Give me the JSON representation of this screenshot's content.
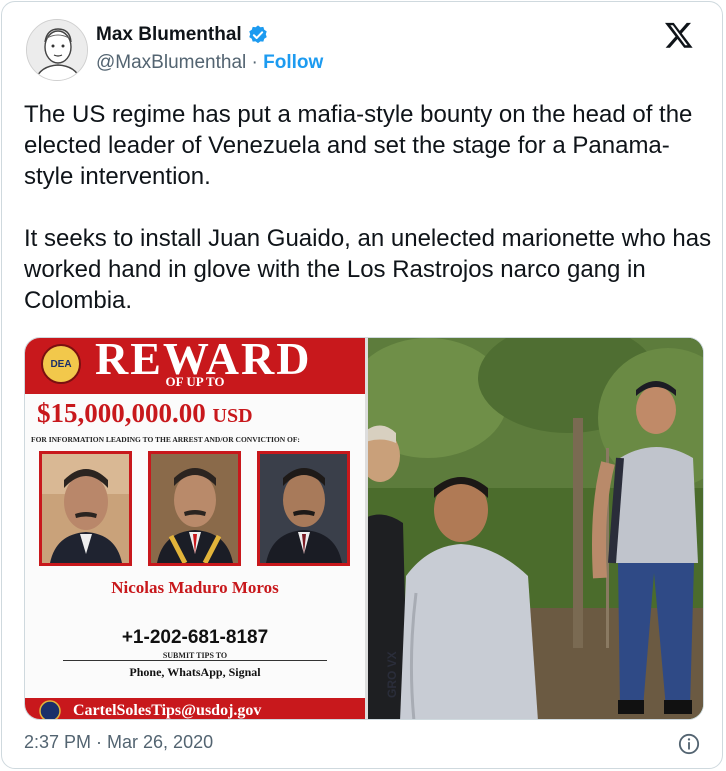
{
  "author": {
    "name": "Max Blumenthal",
    "handle": "@MaxBlumenthal",
    "separator": "·",
    "follow_label": "Follow"
  },
  "icons": {
    "verified": "verified-badge-icon",
    "platform": "x-logo-icon",
    "info": "info-icon"
  },
  "colors": {
    "accent": "#1d9bf0",
    "poster_red": "#c8181c",
    "secondary_text": "#536471"
  },
  "tweet": {
    "text": "The US regime has put a mafia-style bounty on the head of the elected leader of Venezuela and set the stage for a Panama-style intervention.\n\nIt seeks to install Juan Guaido, an unelected marionette who has worked hand in glove with the Los Rastrojos narco gang in Colombia."
  },
  "poster": {
    "seal_text": "DEA",
    "headline": "REWARD",
    "subheadline": "OF UP TO",
    "amount": "$15,000,000.00",
    "currency": "USD",
    "info_line": "FOR INFORMATION LEADING TO THE ARREST AND/OR CONVICTION OF:",
    "person_name": "Nicolas Maduro Moros",
    "phone": "+1-202-681-8187",
    "submit_label": "SUBMIT TIPS TO",
    "channels": "Phone, WhatsApp, Signal",
    "email_partial": "CartelSolesTips@usdoj.gov"
  },
  "photo": {
    "shirt_text": "GRO VX"
  },
  "footer": {
    "timestamp": "2:37 PM · Mar 26, 2020"
  }
}
